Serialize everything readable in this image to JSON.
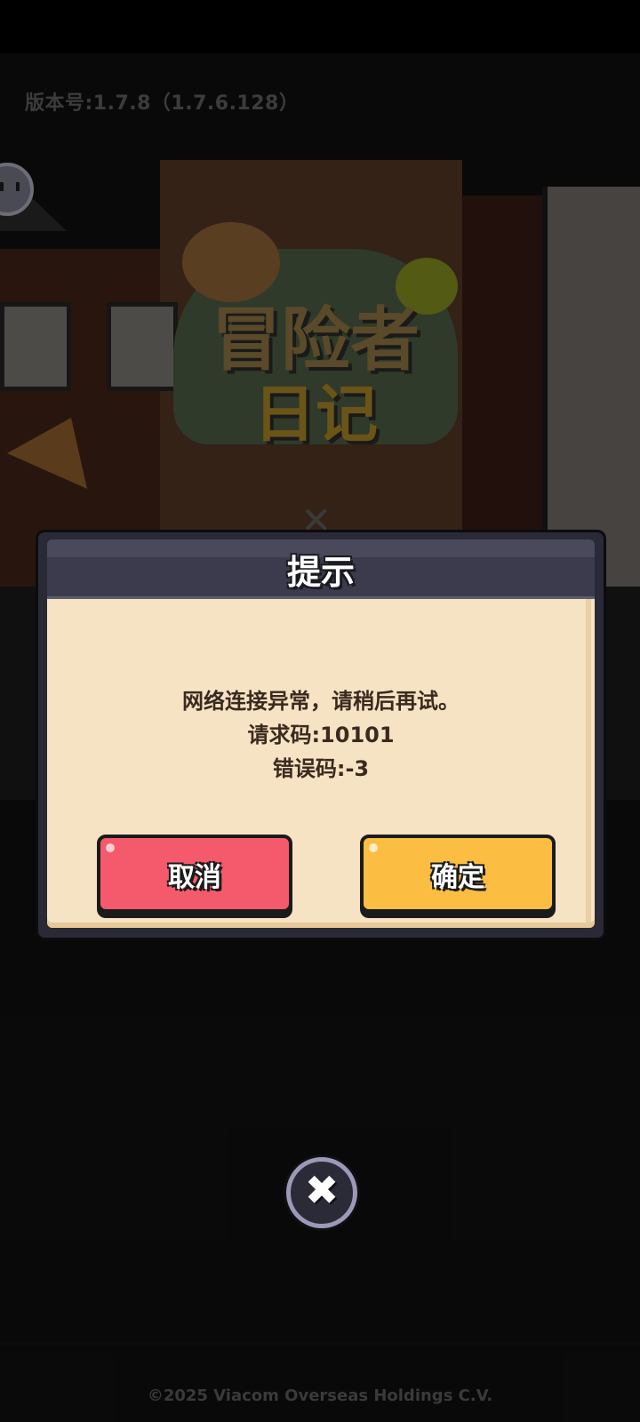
{
  "version_text": "版本号:1.7.8（1.7.6.128）",
  "logo": {
    "line1": "冒险者",
    "line2": "日记"
  },
  "dialog": {
    "title": "提示",
    "message_lines": [
      "网络连接异常，请稍后再试。",
      "请求码:10101",
      "错误码:-3"
    ],
    "cancel_label": "取消",
    "confirm_label": "确定"
  },
  "close_button_glyph": "✖",
  "background_close_glyph": "✕",
  "copyright": "©2025 Viacom Overseas Holdings C.V.",
  "colors": {
    "cancel_button": "#f45a6c",
    "confirm_button": "#fbbe42",
    "dialog_body": "#f6e3c4",
    "dialog_header": "#3c3b4d"
  }
}
